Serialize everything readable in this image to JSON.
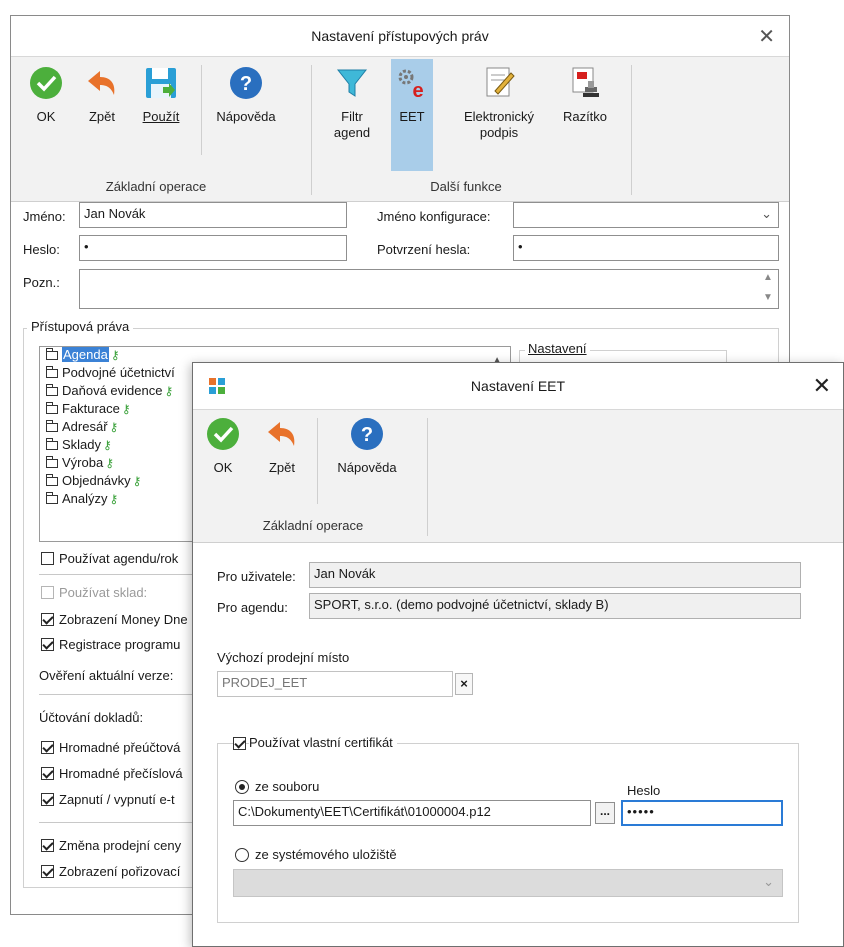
{
  "main_window": {
    "title": "Nastavení přístupových práv",
    "toolbar": {
      "ok": "OK",
      "back": "Zpět",
      "apply": "Použít",
      "help": "Nápověda",
      "filter_line1": "Filtr",
      "filter_line2": "agend",
      "eet": "EET",
      "esign_line1": "Elektronický",
      "esign_line2": "podpis",
      "stamp": "Razítko",
      "group_basic": "Základní operace",
      "group_more": "Další funkce"
    },
    "form": {
      "name_label": "Jméno:",
      "name_value": "Jan Novák",
      "config_label": "Jméno konfigurace:",
      "config_value": "",
      "password_label": "Heslo:",
      "password_value": "•",
      "confirm_label": "Potvrzení hesla:",
      "confirm_value": "•",
      "note_label": "Pozn.:",
      "note_value": ""
    },
    "rights": {
      "group_label": "Přístupová práva",
      "settings_label": "Nastavení",
      "tree": [
        "Agenda",
        "Podvojné účetnictví",
        "Daňová evidence",
        "Fakturace",
        "Adresář",
        "Sklady",
        "Výroba",
        "Objednávky",
        "Analýzy"
      ]
    },
    "options": {
      "use_agenda": "Používat agendu/rok",
      "use_store": "Používat sklad:",
      "show_money": "Zobrazení Money Dne",
      "registration": "Registrace programu",
      "verify_version": "Ověření aktuální verze:",
      "accounting_label": "Účtování dokladů:",
      "bulk_reaccount": "Hromadné přeúčtová",
      "bulk_renumber": "Hromadné přečíslová",
      "toggle_e": "Zapnutí / vypnutí e-t",
      "change_price": "Změna prodejní ceny",
      "show_purchase": "Zobrazení pořizovací"
    }
  },
  "eet_window": {
    "title": "Nastavení EET",
    "toolbar": {
      "ok": "OK",
      "back": "Zpět",
      "help": "Nápověda",
      "group_basic": "Základní operace"
    },
    "for_user_label": "Pro uživatele:",
    "for_user_value": "Jan Novák",
    "for_agenda_label": "Pro agendu:",
    "for_agenda_value": "SPORT, s.r.o. (demo podvojné účetnictví, sklady B)",
    "default_place_label": "Výchozí prodejní místo",
    "default_place_value": "PRODEJ_EET",
    "clear_glyph": "×",
    "own_cert_label": "Používat vlastní certifikát",
    "from_file_label": "ze souboru",
    "password_label": "Heslo",
    "file_path": "C:\\Dokumenty\\EET\\Certifikát\\01000004.p12",
    "browse_label": "...",
    "password_value": "•••••",
    "from_store_label": "ze systémového uložiště",
    "store_value": ""
  },
  "colors": {
    "ok_green": "#4caf3c",
    "back_orange": "#e8722b",
    "help_blue": "#2a6fbf",
    "eet_selected": "#a9cde9",
    "ribbon_bg": "#f2f2f2"
  },
  "icons": [
    "check-circle-icon",
    "undo-arrow-icon",
    "save-disk-icon",
    "help-icon",
    "filter-funnel-icon",
    "eet-gear-icon",
    "signature-icon",
    "stamp-icon",
    "app-logo-icon"
  ]
}
